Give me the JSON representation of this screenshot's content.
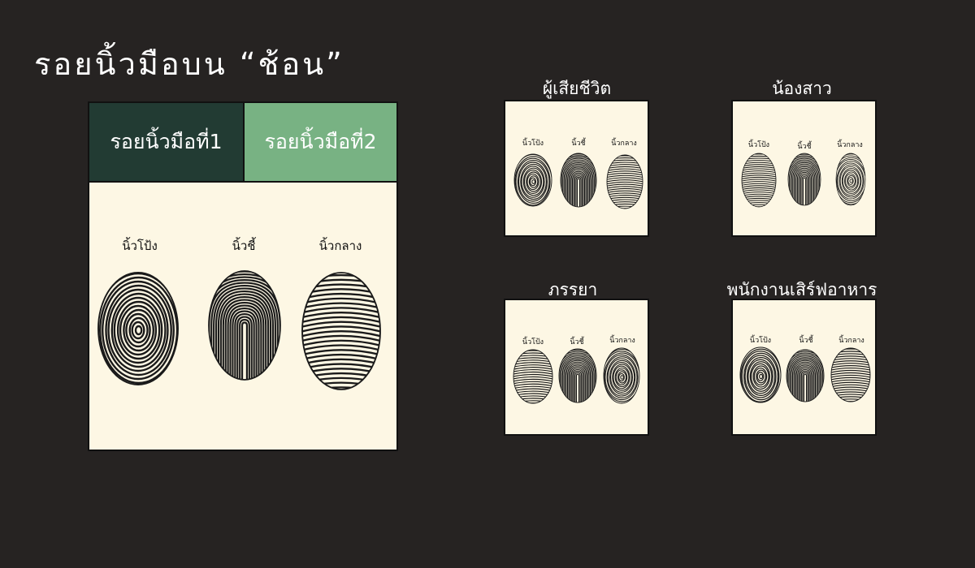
{
  "title": "รอยนิ้วมือบน “ช้อน”",
  "main_panel": {
    "tabs": [
      {
        "label": "รอยนิ้วมือที่1",
        "selected": true,
        "color": "#223b33"
      },
      {
        "label": "รอยนิ้วมือที่2",
        "selected": false,
        "color": "#78b283"
      }
    ],
    "finger_labels": [
      "นิ้วโป้ง",
      "นิ้วชี้",
      "นิ้วกลาง"
    ]
  },
  "suspects": [
    {
      "name": "ผู้เสียชีวิต",
      "finger_labels": [
        "นิ้วโป้ง",
        "นิ้วชี้",
        "นิ้วกลาง"
      ]
    },
    {
      "name": "น้องสาว",
      "finger_labels": [
        "นิ้วโป้ง",
        "นิ้วชี้",
        "นิ้วกลาง"
      ]
    },
    {
      "name": "ภรรยา",
      "finger_labels": [
        "นิ้วโป้ง",
        "นิ้วชี้",
        "นิ้วกลาง"
      ]
    },
    {
      "name": "พนักงานเสิร์ฟอาหาร",
      "finger_labels": [
        "นิ้วโป้ง",
        "นิ้วชี้",
        "นิ้วกลาง"
      ]
    }
  ],
  "colors": {
    "background": "#262322",
    "panel": "#fdf7e4",
    "ink": "#111111"
  }
}
